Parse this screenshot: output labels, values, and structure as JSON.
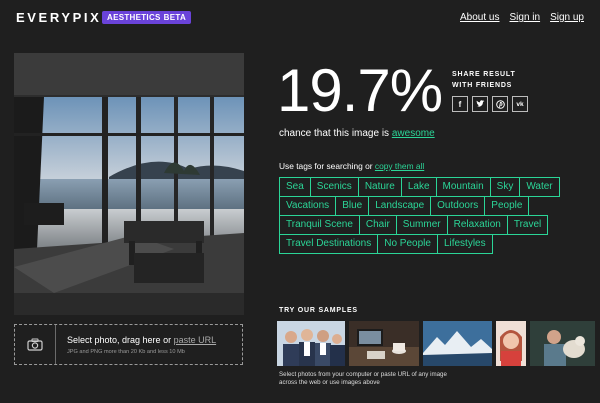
{
  "header": {
    "logo": "EVERYPIXEL",
    "badge": "AESTHETICS",
    "badge_beta": "BETA",
    "nav": [
      "About us",
      "Sign in",
      "Sign up"
    ]
  },
  "result": {
    "percent": "19.7%",
    "chance_prefix": "chance that this image is ",
    "chance_word": "awesome",
    "share_line1": "SHARE RESULT",
    "share_line2": "WITH FRIENDS",
    "share_icons": [
      "facebook-icon",
      "twitter-icon",
      "pinterest-icon",
      "vk-icon"
    ]
  },
  "tags_label_prefix": "Use tags for searching or ",
  "tags_label_link": "copy them all",
  "tags": [
    "Sea",
    "Scenics",
    "Nature",
    "Lake",
    "Mountain",
    "Sky",
    "Water",
    "Vacations",
    "Blue",
    "Landscape",
    "Outdoors",
    "People",
    "Tranquil Scene",
    "Chair",
    "Summer",
    "Relaxation",
    "Travel",
    "Travel Destinations",
    "No People",
    "Lifestyles"
  ],
  "upload": {
    "main_prefix": "Select photo, drag here or ",
    "main_link": "paste URL",
    "sub": "JPG and PNG more than 20 Kb and less 10 Mb"
  },
  "samples": {
    "title": "TRY OUR SAMPLES",
    "note": "Select photos from your computer or paste URL of any image across the web or use images above"
  },
  "colors": {
    "accent": "#2bd597",
    "badge": "#6a43d9",
    "background": "#1f1f1f"
  }
}
